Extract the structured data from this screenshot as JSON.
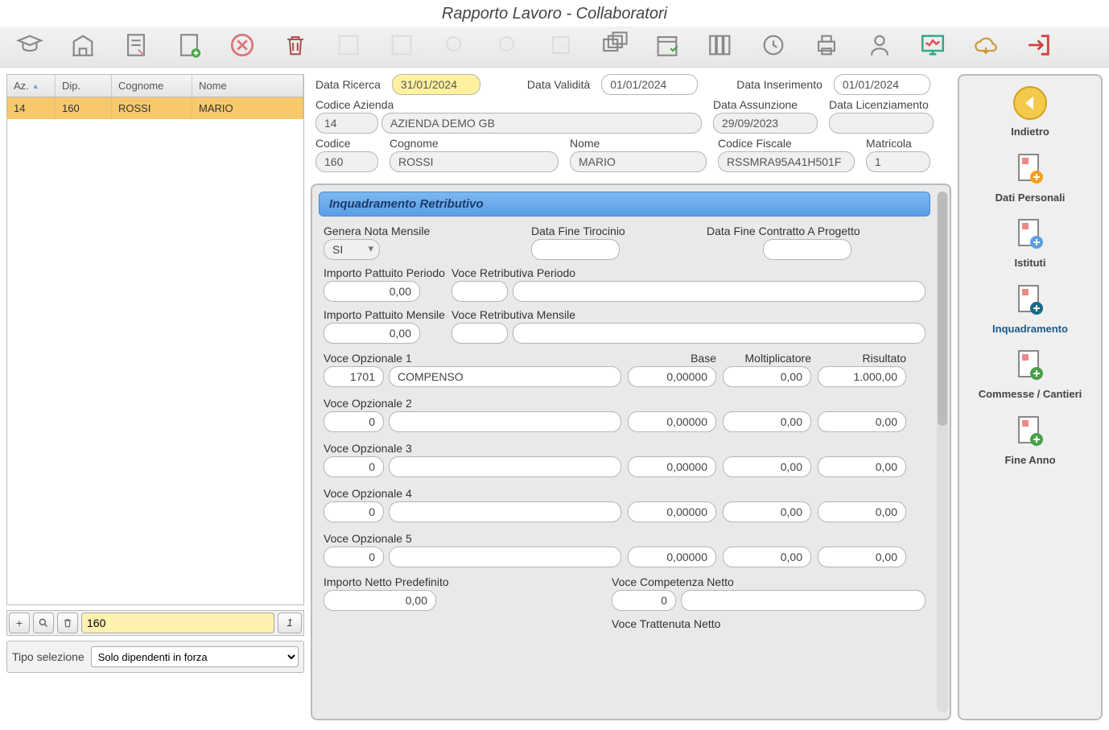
{
  "title": "Rapporto Lavoro - Collaboratori",
  "grid": {
    "headers": {
      "az": "Az.",
      "dip": "Dip.",
      "cognome": "Cognome",
      "nome": "Nome"
    },
    "row": {
      "az": "14",
      "dip": "160",
      "cognome": "ROSSI",
      "nome": "MARIO"
    },
    "search_value": "160",
    "count": "1"
  },
  "selection": {
    "label": "Tipo selezione",
    "value": "Solo dipendenti in forza"
  },
  "top": {
    "data_ricerca_lbl": "Data Ricerca",
    "data_ricerca": "31/01/2024",
    "data_validita_lbl": "Data Validità",
    "data_validita": "01/01/2024",
    "data_inserimento_lbl": "Data Inserimento",
    "data_inserimento": "01/01/2024",
    "codice_azienda_lbl": "Codice Azienda",
    "codice_azienda": "14",
    "azienda_nome": "AZIENDA DEMO GB",
    "data_assunzione_lbl": "Data Assunzione",
    "data_assunzione": "29/09/2023",
    "data_licenziamento_lbl": "Data Licenziamento",
    "data_licenziamento": "",
    "codice_lbl": "Codice",
    "codice": "160",
    "cognome_lbl": "Cognome",
    "cognome": "ROSSI",
    "nome_lbl": "Nome",
    "nome": "MARIO",
    "cf_lbl": "Codice Fiscale",
    "cf": "RSSMRA95A41H501F",
    "matricola_lbl": "Matricola",
    "matricola": "1"
  },
  "section_title": "Inquadramento Retributivo",
  "form": {
    "genera_nota_lbl": "Genera Nota Mensile",
    "genera_nota": "SI",
    "data_fine_tirocinio_lbl": "Data Fine Tirocinio",
    "data_fine_tirocinio": "",
    "data_fine_contratto_lbl": "Data Fine Contratto A Progetto",
    "data_fine_contratto": "",
    "imp_patt_periodo_lbl": "Importo Pattuito Periodo",
    "imp_patt_periodo": "0,00",
    "voce_retr_periodo_lbl": "Voce Retributiva Periodo",
    "voce_retr_periodo_code": "",
    "voce_retr_periodo_desc": "",
    "imp_patt_mensile_lbl": "Importo Pattuito Mensile",
    "imp_patt_mensile": "0,00",
    "voce_retr_mensile_lbl": "Voce Retributiva Mensile",
    "voce_retr_mensile_code": "",
    "voce_retr_mensile_desc": "",
    "base_lbl": "Base",
    "molt_lbl": "Moltiplicatore",
    "ris_lbl": "Risultato",
    "opz": [
      {
        "lbl": "Voce Opzionale 1",
        "code": "1701",
        "desc": "COMPENSO",
        "base": "0,00000",
        "molt": "0,00",
        "ris": "1.000,00"
      },
      {
        "lbl": "Voce Opzionale 2",
        "code": "0",
        "desc": "",
        "base": "0,00000",
        "molt": "0,00",
        "ris": "0,00"
      },
      {
        "lbl": "Voce Opzionale 3",
        "code": "0",
        "desc": "",
        "base": "0,00000",
        "molt": "0,00",
        "ris": "0,00"
      },
      {
        "lbl": "Voce Opzionale 4",
        "code": "0",
        "desc": "",
        "base": "0,00000",
        "molt": "0,00",
        "ris": "0,00"
      },
      {
        "lbl": "Voce Opzionale 5",
        "code": "0",
        "desc": "",
        "base": "0,00000",
        "molt": "0,00",
        "ris": "0,00"
      }
    ],
    "imp_netto_lbl": "Importo Netto Predefinito",
    "imp_netto": "0,00",
    "voce_comp_netto_lbl": "Voce Competenza Netto",
    "voce_comp_netto_code": "0",
    "voce_comp_netto_desc": "",
    "voce_tratt_netto_lbl": "Voce Trattenuta Netto"
  },
  "nav": {
    "indietro": "Indietro",
    "dati_personali": "Dati Personali",
    "istituti": "Istituti",
    "inquadramento": "Inquadramento",
    "commesse": "Commesse / Cantieri",
    "fine_anno": "Fine Anno"
  }
}
